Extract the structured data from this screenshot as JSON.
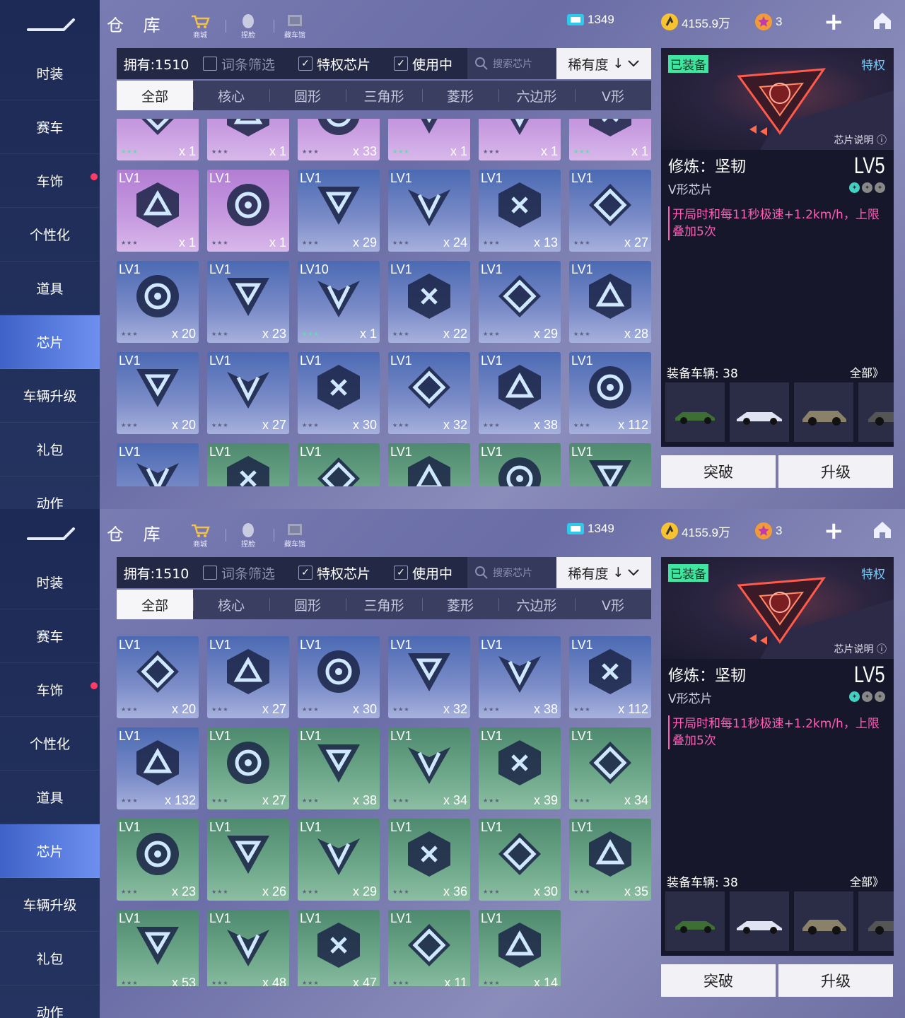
{
  "sidebar": {
    "items": [
      "时装",
      "赛车",
      "车饰",
      "个性化",
      "道具",
      "芯片",
      "车辆升级",
      "礼包",
      "动作"
    ],
    "active_index": 5,
    "notification_index": 2
  },
  "header": {
    "title": "仓 库",
    "buttons": [
      "商城",
      "捏脸",
      "藏车馆"
    ],
    "currency": {
      "tickets": "1349",
      "coins": "4155.9万",
      "gems": "3"
    }
  },
  "filters": {
    "owned": "拥有:1510",
    "keyword_filter": "词条筛选",
    "privilege_chip": "特权芯片",
    "in_use": "使用中",
    "search_placeholder": "搜索芯片",
    "sort_label": "稀有度"
  },
  "tabs": [
    "全部",
    "核心",
    "圆形",
    "三角形",
    "菱形",
    "六边形",
    "V形"
  ],
  "screen1": {
    "cards": [
      {
        "lv": "",
        "count": "x 1",
        "color": "purple",
        "stars": "green"
      },
      {
        "lv": "",
        "count": "x 1",
        "color": "purple",
        "stars": "grey"
      },
      {
        "lv": "",
        "count": "x 33",
        "color": "purple",
        "stars": "grey"
      },
      {
        "lv": "",
        "count": "x 1",
        "color": "purple",
        "stars": "green"
      },
      {
        "lv": "",
        "count": "x 1",
        "color": "purple",
        "stars": "grey"
      },
      {
        "lv": "",
        "count": "x 1",
        "color": "purple",
        "stars": "green"
      },
      {
        "lv": "LV1",
        "count": "x 1",
        "color": "purple",
        "stars": "grey"
      },
      {
        "lv": "LV1",
        "count": "x 1",
        "color": "purple",
        "stars": "grey"
      },
      {
        "lv": "LV1",
        "count": "x 29",
        "color": "blue",
        "stars": "grey"
      },
      {
        "lv": "LV1",
        "count": "x 24",
        "color": "blue",
        "stars": "grey"
      },
      {
        "lv": "LV1",
        "count": "x 13",
        "color": "blue",
        "stars": "grey"
      },
      {
        "lv": "LV1",
        "count": "x 27",
        "color": "blue",
        "stars": "grey"
      },
      {
        "lv": "LV1",
        "count": "x 20",
        "color": "blue",
        "stars": "grey"
      },
      {
        "lv": "LV1",
        "count": "x 23",
        "color": "blue",
        "stars": "grey"
      },
      {
        "lv": "LV10",
        "count": "x 1",
        "color": "blue",
        "stars": "green"
      },
      {
        "lv": "LV1",
        "count": "x 22",
        "color": "blue",
        "stars": "grey"
      },
      {
        "lv": "LV1",
        "count": "x 29",
        "color": "blue",
        "stars": "grey"
      },
      {
        "lv": "LV1",
        "count": "x 28",
        "color": "blue",
        "stars": "grey"
      },
      {
        "lv": "LV1",
        "count": "x 20",
        "color": "blue",
        "stars": "grey"
      },
      {
        "lv": "LV1",
        "count": "x 27",
        "color": "blue",
        "stars": "grey"
      },
      {
        "lv": "LV1",
        "count": "x 30",
        "color": "blue",
        "stars": "grey"
      },
      {
        "lv": "LV1",
        "count": "x 32",
        "color": "blue",
        "stars": "grey"
      },
      {
        "lv": "LV1",
        "count": "x 38",
        "color": "blue",
        "stars": "grey"
      },
      {
        "lv": "LV1",
        "count": "x 112",
        "color": "blue",
        "stars": "grey"
      },
      {
        "lv": "LV1",
        "count": "",
        "color": "blue",
        "stars": "grey"
      },
      {
        "lv": "LV1",
        "count": "",
        "color": "green",
        "stars": "grey"
      },
      {
        "lv": "LV1",
        "count": "",
        "color": "green",
        "stars": "grey"
      },
      {
        "lv": "LV1",
        "count": "",
        "color": "green",
        "stars": "grey"
      },
      {
        "lv": "LV1",
        "count": "",
        "color": "green",
        "stars": "grey"
      },
      {
        "lv": "LV1",
        "count": "",
        "color": "green",
        "stars": "grey"
      }
    ]
  },
  "screen2": {
    "cards": [
      {
        "lv": "LV1",
        "count": "x 20",
        "color": "blue",
        "stars": "grey"
      },
      {
        "lv": "LV1",
        "count": "x 27",
        "color": "blue",
        "stars": "grey"
      },
      {
        "lv": "LV1",
        "count": "x 30",
        "color": "blue",
        "stars": "grey"
      },
      {
        "lv": "LV1",
        "count": "x 32",
        "color": "blue",
        "stars": "grey"
      },
      {
        "lv": "LV1",
        "count": "x 38",
        "color": "blue",
        "stars": "grey"
      },
      {
        "lv": "LV1",
        "count": "x 112",
        "color": "blue",
        "stars": "grey"
      },
      {
        "lv": "LV1",
        "count": "x 132",
        "color": "blue",
        "stars": "grey"
      },
      {
        "lv": "LV1",
        "count": "x 27",
        "color": "green",
        "stars": "grey"
      },
      {
        "lv": "LV1",
        "count": "x 38",
        "color": "green",
        "stars": "grey"
      },
      {
        "lv": "LV1",
        "count": "x 34",
        "color": "green",
        "stars": "grey"
      },
      {
        "lv": "LV1",
        "count": "x 39",
        "color": "green",
        "stars": "grey"
      },
      {
        "lv": "LV1",
        "count": "x 34",
        "color": "green",
        "stars": "grey"
      },
      {
        "lv": "LV1",
        "count": "x 23",
        "color": "green",
        "stars": "grey"
      },
      {
        "lv": "LV1",
        "count": "x 26",
        "color": "green",
        "stars": "grey"
      },
      {
        "lv": "LV1",
        "count": "x 29",
        "color": "green",
        "stars": "grey"
      },
      {
        "lv": "LV1",
        "count": "x 36",
        "color": "green",
        "stars": "grey"
      },
      {
        "lv": "LV1",
        "count": "x 30",
        "color": "green",
        "stars": "grey"
      },
      {
        "lv": "LV1",
        "count": "x 35",
        "color": "green",
        "stars": "grey"
      },
      {
        "lv": "LV1",
        "count": "x 53",
        "color": "green",
        "stars": "grey"
      },
      {
        "lv": "LV1",
        "count": "x 48",
        "color": "green",
        "stars": "grey"
      },
      {
        "lv": "LV1",
        "count": "x 47",
        "color": "green",
        "stars": "grey"
      },
      {
        "lv": "LV1",
        "count": "x 11",
        "color": "green",
        "stars": "grey"
      },
      {
        "lv": "LV1",
        "count": "x 14",
        "color": "green",
        "stars": "grey"
      }
    ]
  },
  "detail": {
    "equipped_badge": "已装备",
    "privilege_tag": "特权",
    "description_link": "芯片说明",
    "name": "修炼：坚韧",
    "level": "LV5",
    "type": "V形芯片",
    "effect": "开局时和每11秒极速+1.2km/h，上限叠加5次",
    "vehicles_label": "装备车辆: 38",
    "vehicles_all": "全部》",
    "breakthrough_button": "突破",
    "upgrade_button": "升级"
  },
  "colors": {
    "accent_active_tab": "#f6f6f8",
    "equipped_green": "#3ee6a0",
    "effect_pink": "#ff5eb8",
    "privilege_blue": "#6fd0ff",
    "notification_red": "#ff3b66"
  }
}
